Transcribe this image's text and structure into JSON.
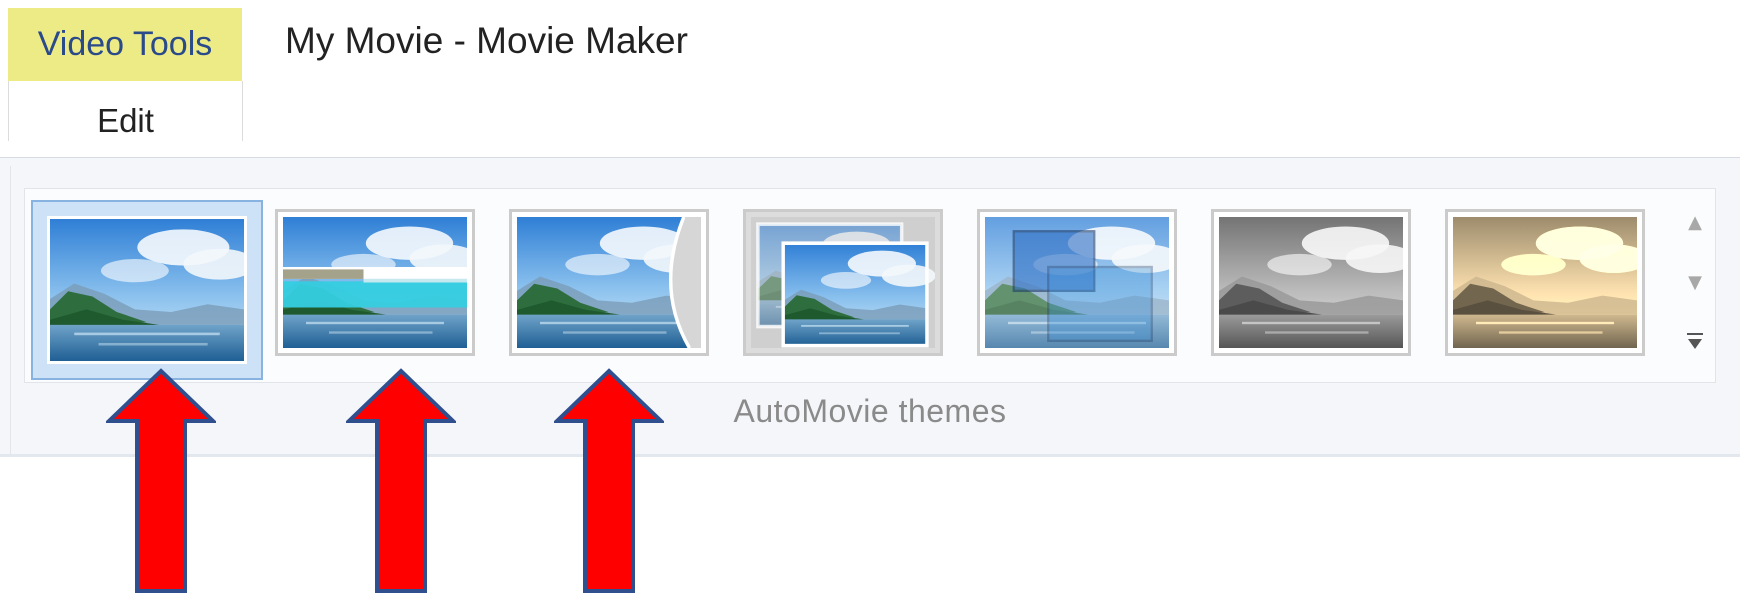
{
  "contextual_tab": {
    "group_label": "Video Tools",
    "tab_label": "Edit",
    "color": "#eceb86"
  },
  "window": {
    "title": "My Movie - Movie Maker"
  },
  "ribbon": {
    "group_label": "AutoMovie themes",
    "themes": [
      {
        "icon": "theme-default-thumbnail",
        "selected": true
      },
      {
        "icon": "theme-contemporary-thumbnail",
        "selected": false
      },
      {
        "icon": "theme-cinematic-thumbnail",
        "selected": false
      },
      {
        "icon": "theme-fade-thumbnail",
        "selected": false
      },
      {
        "icon": "theme-pan-zoom-thumbnail",
        "selected": false
      },
      {
        "icon": "theme-black-and-white-thumbnail",
        "selected": false
      },
      {
        "icon": "theme-sepia-thumbnail",
        "selected": false
      }
    ],
    "scroll": {
      "up_icon": "scroll-up-icon",
      "down_icon": "scroll-down-icon",
      "more_icon": "gallery-more-icon"
    }
  },
  "annotation": {
    "arrow_count": 3,
    "arrow_color": "#ff0000",
    "arrow_outline": "#2f4f8f"
  }
}
